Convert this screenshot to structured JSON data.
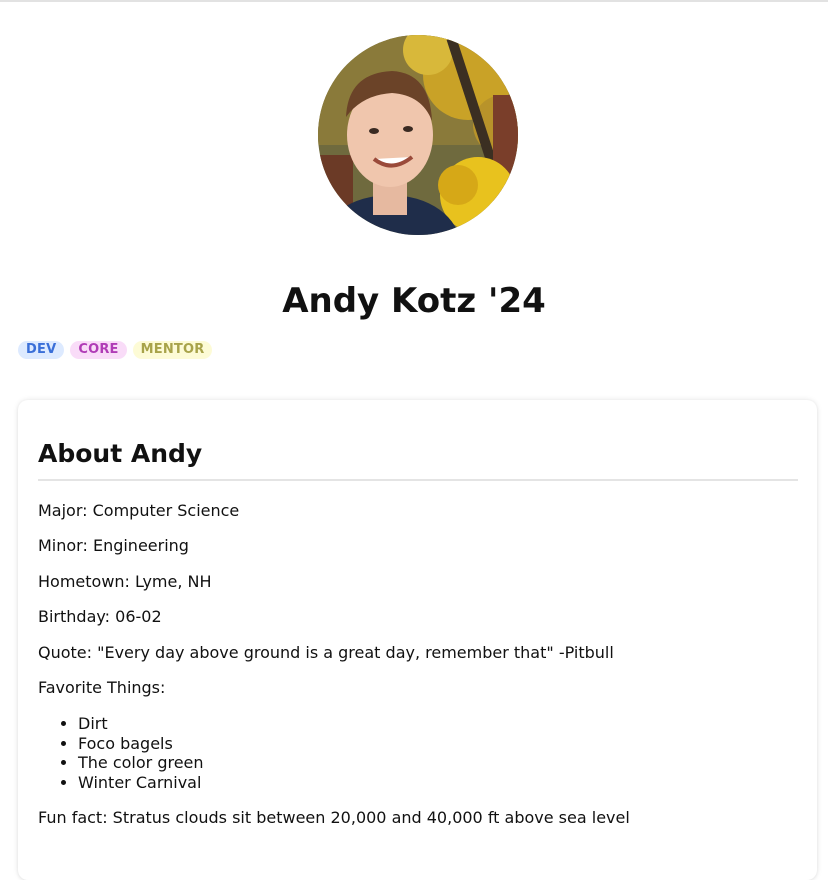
{
  "profile": {
    "name": "Andy Kotz '24",
    "badges": [
      {
        "label": "DEV",
        "color": "#3a6fd8",
        "background": "#ddeaff"
      },
      {
        "label": "CORE",
        "color": "#b03cb6",
        "background": "#f9dcf8"
      },
      {
        "label": "MENTOR",
        "color": "#a8a34a",
        "background": "#fdfbd6"
      }
    ],
    "avatar_icon": "profile-photo"
  },
  "about": {
    "title": "About Andy",
    "major": "Major: Computer Science",
    "minor": "Minor: Engineering",
    "hometown": "Hometown: Lyme, NH",
    "birthday": "Birthday: 06-02",
    "quote": "Quote: \"Every day above ground is a great day, remember that\" -Pitbull",
    "favorites_label": "Favorite Things:",
    "favorites": [
      "Dirt",
      "Foco bagels",
      "The color green",
      "Winter Carnival"
    ],
    "fun_fact": "Fun fact: Stratus clouds sit between 20,000 and 40,000 ft above sea level"
  }
}
